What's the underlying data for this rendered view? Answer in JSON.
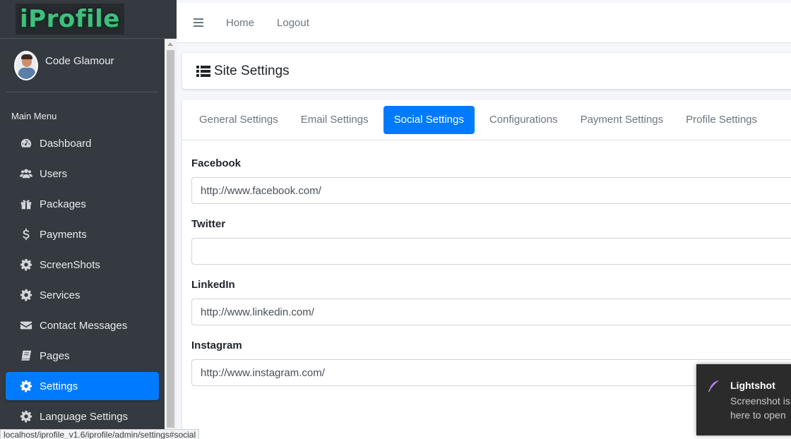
{
  "brand": {
    "logo_text": "iProfile",
    "logo_color": "#3fbf7f"
  },
  "user": {
    "name": "Code Glamour"
  },
  "sidebar": {
    "menu_header": "Main Menu",
    "items": [
      {
        "label": "Dashboard",
        "icon": "tachometer-icon"
      },
      {
        "label": "Users",
        "icon": "users-icon"
      },
      {
        "label": "Packages",
        "icon": "gift-icon"
      },
      {
        "label": "Payments",
        "icon": "dollar-icon"
      },
      {
        "label": "ScreenShots",
        "icon": "gear-icon"
      },
      {
        "label": "Services",
        "icon": "gear-icon"
      },
      {
        "label": "Contact Messages",
        "icon": "envelope-icon"
      },
      {
        "label": "Pages",
        "icon": "book-icon"
      },
      {
        "label": "Settings",
        "icon": "gear-icon",
        "active": true
      },
      {
        "label": "Language Settings",
        "icon": "gear-icon"
      }
    ]
  },
  "topbar": {
    "home_label": "Home",
    "logout_label": "Logout"
  },
  "page": {
    "title": "Site Settings"
  },
  "tabs": [
    {
      "label": "General Settings"
    },
    {
      "label": "Email Settings"
    },
    {
      "label": "Social Settings",
      "active": true
    },
    {
      "label": "Configurations"
    },
    {
      "label": "Payment Settings"
    },
    {
      "label": "Profile Settings"
    }
  ],
  "form": {
    "facebook": {
      "label": "Facebook",
      "value": "http://www.facebook.com/"
    },
    "twitter": {
      "label": "Twitter",
      "value": ""
    },
    "linkedin": {
      "label": "LinkedIn",
      "value": "http://www.linkedin.com/"
    },
    "instagram": {
      "label": "Instagram",
      "value": "http://www.instagram.com/"
    }
  },
  "toast": {
    "title": "Lightshot",
    "line1": "Screenshot is",
    "line2": "here to open"
  },
  "statusbar": {
    "url": "localhost/iprofile_v1.6/iprofile/admin/settings#social"
  },
  "colors": {
    "accent": "#007bff",
    "sidebar_bg": "#343a40"
  }
}
